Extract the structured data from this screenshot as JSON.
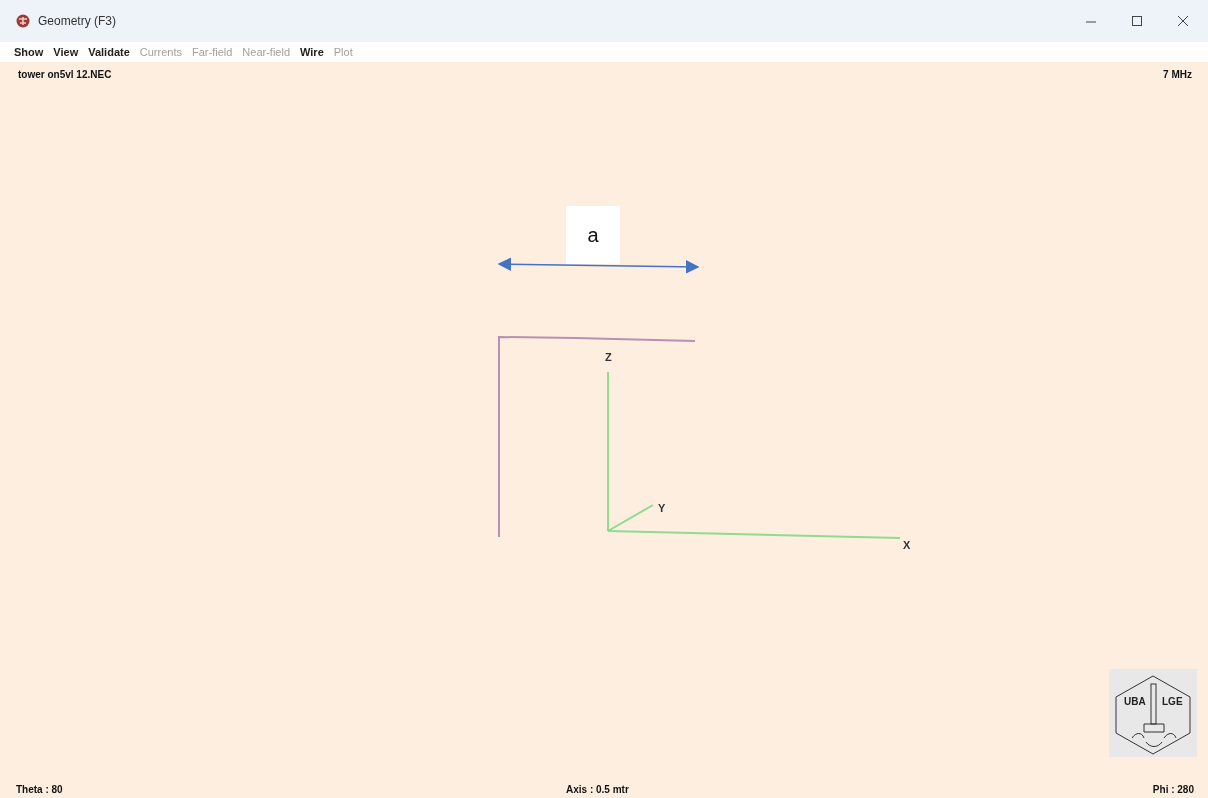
{
  "window": {
    "title": "Geometry  (F3)"
  },
  "menu": [
    {
      "label": "Show",
      "disabled": false
    },
    {
      "label": "View",
      "disabled": false
    },
    {
      "label": "Validate",
      "disabled": false
    },
    {
      "label": "Currents",
      "disabled": true
    },
    {
      "label": "Far-field",
      "disabled": true
    },
    {
      "label": "Near-field",
      "disabled": true
    },
    {
      "label": "Wire",
      "disabled": false
    },
    {
      "label": "Plot",
      "disabled": true
    }
  ],
  "canvas": {
    "file_name": "tower on5vl 12.NEC",
    "frequency": "7 MHz",
    "annotation": "a",
    "axis_labels": [
      "Z",
      "Y",
      "X"
    ],
    "logo": {
      "left_text": "UBA",
      "right_text": "LGE"
    },
    "status": {
      "theta": "Theta : 80",
      "axis": "Axis : 0.5 mtr",
      "phi": "Phi : 280"
    }
  }
}
